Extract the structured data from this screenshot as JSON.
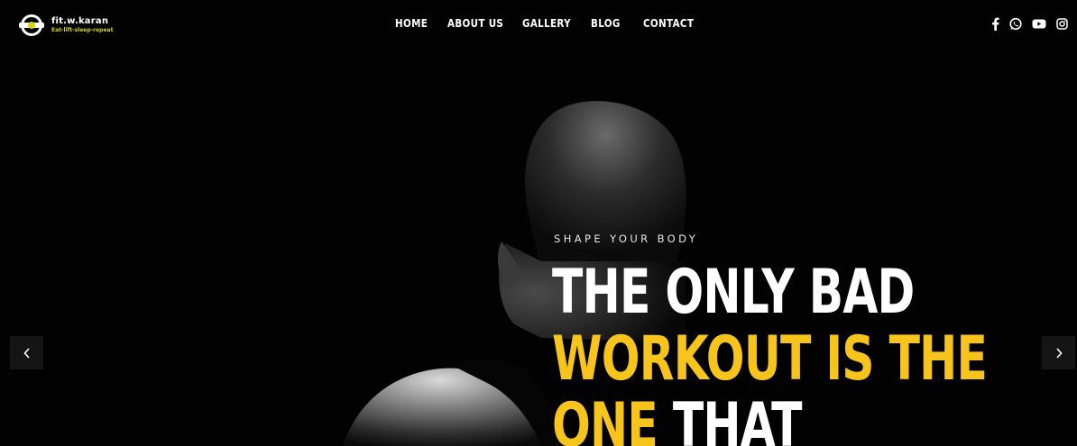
{
  "brand": {
    "name": "fit.w.karan",
    "tagline": "Eat-lift-sleep-repeat",
    "accent_color": "#d8d300"
  },
  "nav": {
    "items": [
      {
        "label": "HOME"
      },
      {
        "label": "ABOUT US"
      },
      {
        "label": "GALLERY"
      },
      {
        "label": "BLOG"
      },
      {
        "label": "CONTACT"
      }
    ]
  },
  "social": {
    "icons": [
      "facebook-icon",
      "whatsapp-icon",
      "youtube-icon",
      "instagram-icon"
    ]
  },
  "hero": {
    "eyebrow": "SHAPE YOUR BODY",
    "line1": "THE ONLY BAD",
    "line2": "WORKOUT IS THE",
    "line3_yellow": "ONE",
    "line3_white": " THAT",
    "highlight_color": "#f6c41a",
    "image": "athlete-back-silhouette"
  },
  "slider": {
    "prev_icon": "chevron-left-icon",
    "next_icon": "chevron-right-icon"
  }
}
